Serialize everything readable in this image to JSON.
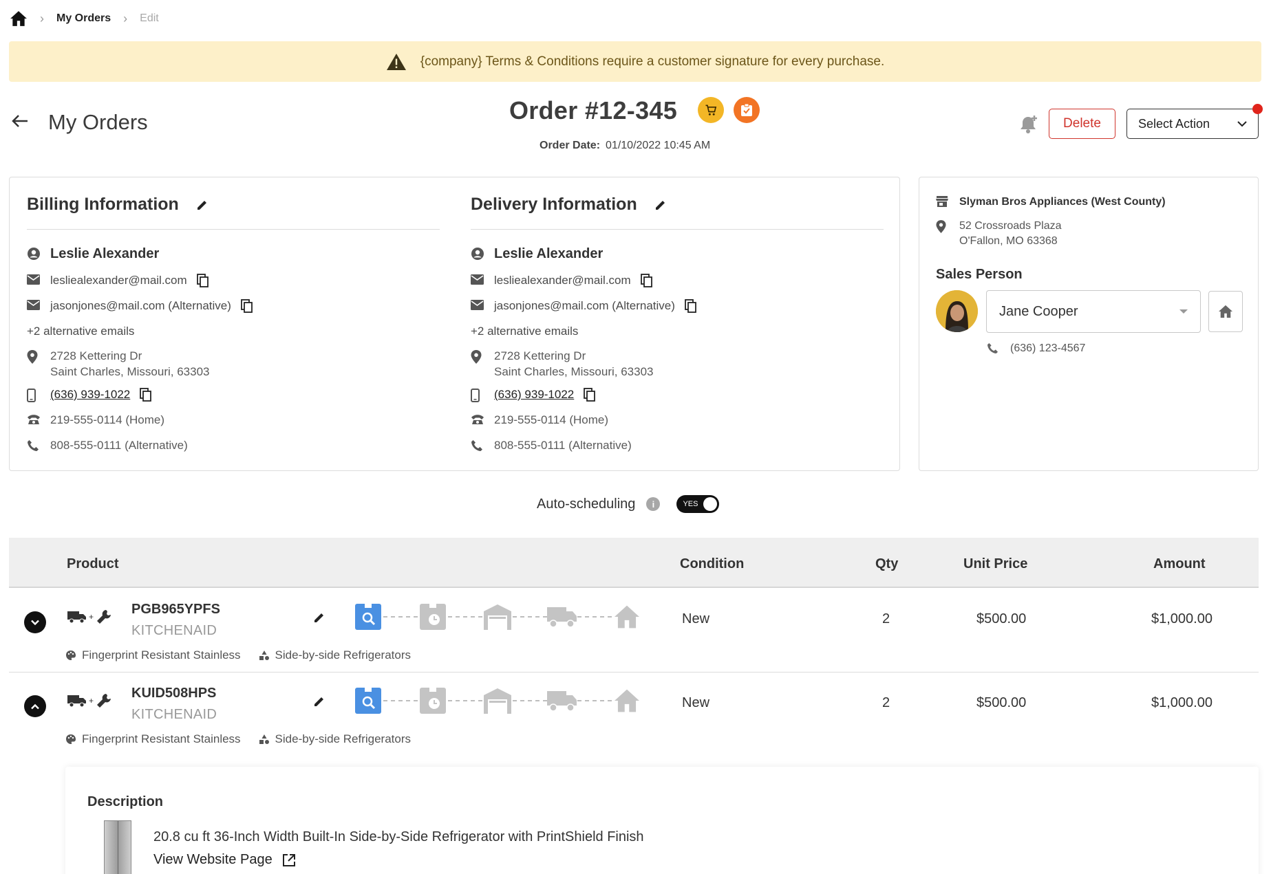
{
  "breadcrumb": {
    "current": "My Orders",
    "next": "Edit"
  },
  "banner": {
    "text": "{company} Terms & Conditions require a customer signature for every purchase."
  },
  "header": {
    "back_title": "My Orders",
    "order_title": "Order #12-345",
    "order_date_label": "Order Date:",
    "order_date_value": "01/10/2022 10:45 AM",
    "delete_label": "Delete",
    "select_action_label": "Select Action"
  },
  "billing": {
    "title": "Billing Information",
    "name": "Leslie Alexander",
    "email": "lesliealexander@mail.com",
    "alt_email": "jasonjones@mail.com (Alternative)",
    "more_emails": "+2 alternative emails",
    "address_line1": "2728 Kettering Dr",
    "address_line2": "Saint Charles, Missouri, 63303",
    "mobile": "(636) 939-1022",
    "home_phone": "219-555-0114",
    "home_label": "(Home)",
    "alt_phone": "808-555-0111",
    "alt_label": "(Alternative)"
  },
  "delivery": {
    "title": "Delivery Information",
    "name": "Leslie Alexander",
    "email": "lesliealexander@mail.com",
    "alt_email": "jasonjones@mail.com (Alternative)",
    "more_emails": "+2 alternative emails",
    "address_line1": "2728 Kettering Dr",
    "address_line2": "Saint Charles, Missouri, 63303",
    "mobile": "(636) 939-1022",
    "home_phone": "219-555-0114",
    "home_label": "(Home)",
    "alt_phone": "808-555-0111",
    "alt_label": "(Alternative)"
  },
  "store": {
    "name": "Slyman Bros Appliances (West County)",
    "address_line1": "52 Crossroads Plaza",
    "address_line2": "O'Fallon, MO 63368",
    "sales_person_title": "Sales Person",
    "sales_person_name": "Jane Cooper",
    "sales_person_phone": "(636) 123-4567"
  },
  "auto_scheduling": {
    "label": "Auto-scheduling",
    "toggle_text": "YES",
    "enabled": true
  },
  "table": {
    "headers": {
      "product": "Product",
      "condition": "Condition",
      "qty": "Qty",
      "unit_price": "Unit Price",
      "amount": "Amount"
    },
    "rows": [
      {
        "sku": "PGB965YPFS",
        "brand": "KITCHENAID",
        "finish": "Fingerprint Resistant Stainless",
        "category": "Side-by-side Refrigerators",
        "condition": "New",
        "qty": "2",
        "unit_price": "$500.00",
        "amount": "$1,000.00",
        "expanded": false
      },
      {
        "sku": "KUID508HPS",
        "brand": "KITCHENAID",
        "finish": "Fingerprint Resistant Stainless",
        "category": "Side-by-side Refrigerators",
        "condition": "New",
        "qty": "2",
        "unit_price": "$500.00",
        "amount": "$1,000.00",
        "expanded": true
      }
    ]
  },
  "description": {
    "title": "Description",
    "text": "20.8 cu ft 36-Inch Width Built-In Side-by-Side Refrigerator with PrintShield Finish",
    "link_label": "View Website Page"
  },
  "colors": {
    "banner_bg": "#fdf0c9",
    "delete_red": "#d0342c",
    "badge_yellow": "#f3b626",
    "badge_orange": "#f27424",
    "active_step_blue": "#4a90e2"
  },
  "icons": {
    "pipeline_steps": [
      "inspection-icon",
      "scheduled-icon",
      "warehouse-icon",
      "truck-icon",
      "home-icon"
    ]
  }
}
